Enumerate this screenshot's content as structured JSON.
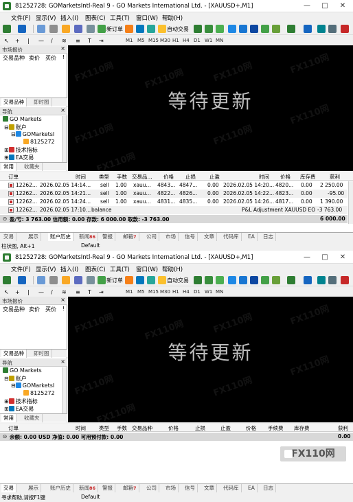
{
  "title": "81252728: GOMarketsIntl-Real 9 - GO Markets International Ltd. - [XAUUSD+,M1]",
  "window_controls": [
    "—",
    "□",
    "✕"
  ],
  "menu": [
    "文件(F)",
    "显示(V)",
    "插入(I)",
    "图表(C)",
    "工具(T)",
    "窗口(W)",
    "帮助(H)"
  ],
  "toolbar": {
    "new_order": "新订单",
    "auto_trade": "自动交易"
  },
  "periods": [
    "M1",
    "M5",
    "M15",
    "M30",
    "H1",
    "H4",
    "D1",
    "W1",
    "MN"
  ],
  "market_watch": {
    "title": "市场报价",
    "cols": [
      "交易品种",
      "卖价",
      "买价",
      "!"
    ],
    "tabs": [
      "交易品种",
      "即时图"
    ]
  },
  "navigator": {
    "title": "导航",
    "items": [
      "GO Markets",
      "账户",
      "GOMarketsI",
      "8125272",
      "技术指标",
      "EA交易"
    ],
    "tabs": [
      "常用",
      "收藏夹"
    ]
  },
  "chart": {
    "waiting_text": "等待更新",
    "watermark": "FX110网"
  },
  "history": {
    "headers": [
      "订单",
      "时间",
      "类型",
      "手数",
      "交易品...",
      "价格",
      "止损",
      "止盈",
      "时间",
      "价格",
      "库存费",
      "获利"
    ],
    "rows": [
      [
        "12262...",
        "2026.02.05 14:14...",
        "sell",
        "1.00",
        "xauu...",
        "4843...",
        "4847...",
        "0.00",
        "2026.02.05 14:20...",
        "4820...",
        "0.00",
        "2 250.00"
      ],
      [
        "12262...",
        "2026.02.05 14:21...",
        "sell",
        "1.00",
        "xauu...",
        "4822...",
        "4826...",
        "0.00",
        "2026.02.05 14:22...",
        "4823...",
        "0.00",
        "-95.00"
      ],
      [
        "12262...",
        "2026.02.05 14:24...",
        "sell",
        "1.00",
        "xauu...",
        "4831...",
        "4835...",
        "0.00",
        "2026.02.05 14:26...",
        "4817...",
        "0.00",
        "1 390.00"
      ]
    ],
    "balance_row": {
      "id": "12262...",
      "time": "2026.02.05 17:10...",
      "type": "balance",
      "comment": "P&L Adjustment XAUUSD EO",
      "profit": "-3 763.00"
    },
    "summary": {
      "text": "盈/亏: 3 763.00  信用额: 0.00  存款: 6 000.00  取款: -3 763.00",
      "total": "6 000.00"
    }
  },
  "trade": {
    "headers": [
      "订单",
      "时间",
      "类型",
      "手数",
      "交易品种",
      "价格",
      "止损",
      "止盈",
      "价格",
      "手续费",
      "库存费",
      "获利"
    ],
    "summary": {
      "text": "余额: 0.00 USD  净值: 0.00  可用预付款: 0.00",
      "total": "0.00"
    }
  },
  "bottom_tabs": {
    "w1": [
      "交易",
      "展示",
      "账户历史",
      "新闻",
      "警报",
      "邮箱",
      "公司",
      "市场",
      "信号",
      "文章",
      "代码库",
      "EA",
      "日志"
    ],
    "w2": [
      "交易",
      "展示",
      "账户历史",
      "新闻",
      "警报",
      "邮箱",
      "公司",
      "市场",
      "信号",
      "文章",
      "代码库",
      "EA",
      "日志"
    ],
    "news_count": "86",
    "mail_count": "7"
  },
  "status1": {
    "left": "柱状图, Alt+1",
    "middle": "Default"
  },
  "status2": {
    "left": "寻求帮助,请按F1键",
    "middle": "Default"
  },
  "logo_watermark": "FX110网",
  "colors": {
    "chart_bg": "#000000",
    "chart_text": "#bdbdbd",
    "negative": "#c62828"
  }
}
